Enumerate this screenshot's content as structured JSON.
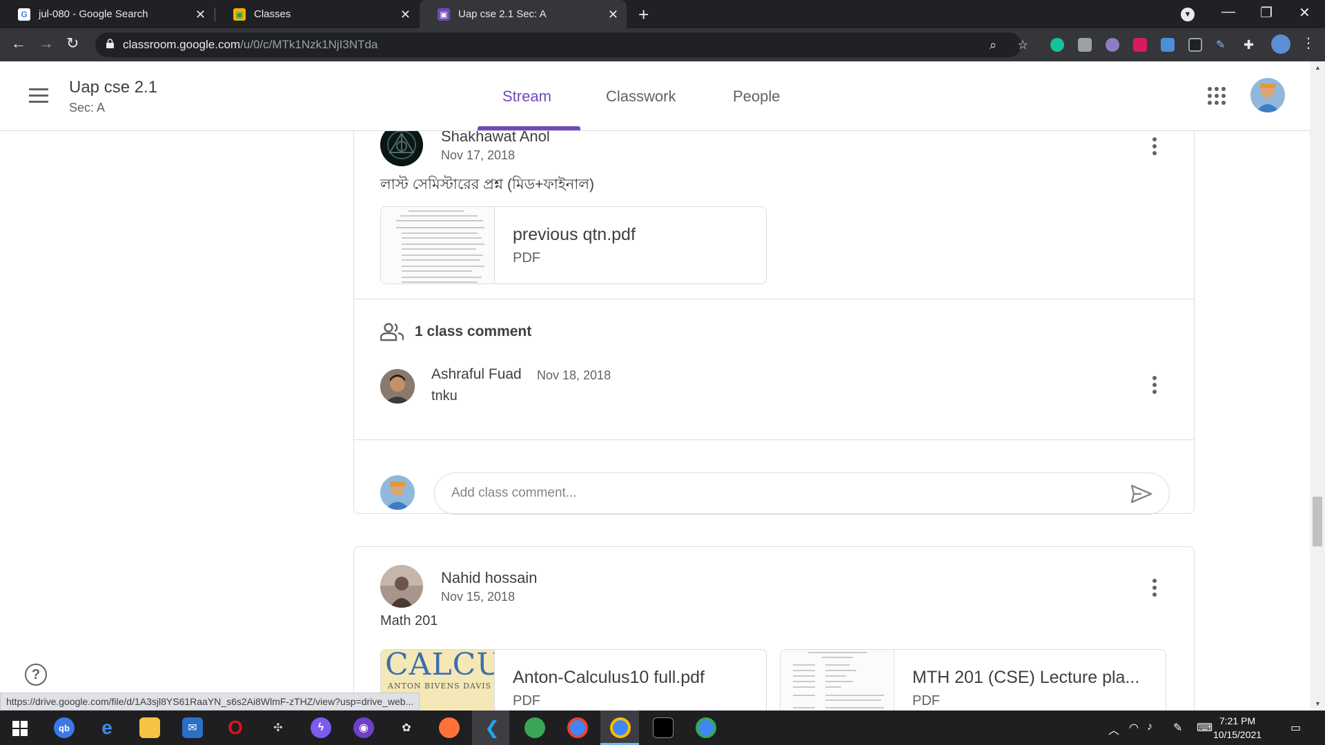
{
  "browser": {
    "tabs": [
      {
        "title": "jul-080 - Google Search",
        "icon": "google-g-icon",
        "active": false
      },
      {
        "title": "Classes",
        "icon": "classroom-icon",
        "active": false
      },
      {
        "title": "Uap cse 2.1 Sec: A",
        "icon": "classroom-icon",
        "active": true
      }
    ],
    "url_host": "classroom.google.com",
    "url_path": "/u/0/c/MTk1Nzk1NjI3NTda"
  },
  "classroom": {
    "class_name": "Uap cse 2.1",
    "section": "Sec: A",
    "nav_tabs": [
      "Stream",
      "Classwork",
      "People"
    ],
    "active_tab": "Stream"
  },
  "posts": [
    {
      "author": "Shakhawat Anol",
      "date": "Nov 17, 2018",
      "text": "লাস্ট সেমিস্টারের প্রশ্ন (মিড+ফাইনাল)",
      "attachments": [
        {
          "name": "previous qtn.pdf",
          "type": "PDF"
        }
      ],
      "comment_count_label": "1 class comment",
      "comments": [
        {
          "author": "Ashraful Fuad",
          "date": "Nov 18, 2018",
          "text": "tnku"
        }
      ],
      "comment_placeholder": "Add class comment..."
    },
    {
      "author": "Nahid hossain",
      "date": "Nov 15, 2018",
      "text": "Math 201",
      "attachments": [
        {
          "name": "Anton-Calculus10 full.pdf",
          "type": "PDF",
          "thumb_text": "CALCULUS",
          "thumb_sub": "ANTON BIVENS DAVIS"
        },
        {
          "name": "MTH 201 (CSE) Lecture pla...",
          "type": "PDF"
        }
      ]
    }
  ],
  "status_url": "https://drive.google.com/file/d/1A3sjl8YS61RaaYN_s6s2Ai8WlmF-zTHZ/view?usp=drive_web...",
  "taskbar": {
    "time": "7:21 PM",
    "date": "10/15/2021"
  },
  "colors": {
    "accent": "#7248b9",
    "chrome_dark": "#202124",
    "chrome_toolbar": "#35363a"
  }
}
